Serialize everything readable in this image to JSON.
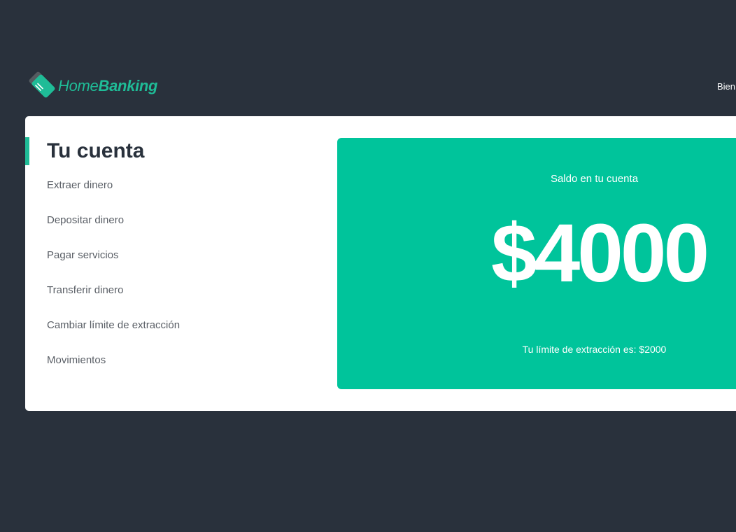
{
  "header": {
    "brand_light": "Home",
    "brand_bold": "Banking",
    "welcome": "Bien"
  },
  "account": {
    "title": "Tu cuenta",
    "menu": [
      "Extraer dinero",
      "Depositar dinero",
      "Pagar servicios",
      "Transferir dinero",
      "Cambiar límite de extracción",
      "Movimientos"
    ]
  },
  "balance": {
    "label": "Saldo en tu cuenta",
    "amount": "$4000",
    "limit_text": "Tu límite de extracción es: $2000"
  },
  "colors": {
    "background": "#29313c",
    "accent": "#00c49b",
    "brand": "#1fbc97",
    "card": "#ffffff"
  }
}
